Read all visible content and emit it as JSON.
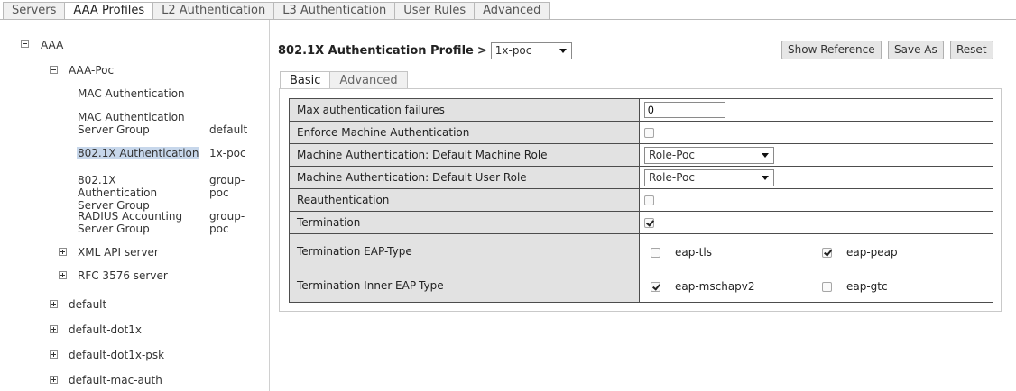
{
  "top_tabs": [
    {
      "label": "Servers"
    },
    {
      "label": "AAA Profiles",
      "active": true
    },
    {
      "label": "L2 Authentication"
    },
    {
      "label": "L3 Authentication"
    },
    {
      "label": "User Rules"
    },
    {
      "label": "Advanced"
    }
  ],
  "tree": {
    "root": "AAA",
    "aaa_poc": "AAA-Poc",
    "mac_auth": "MAC Authentication",
    "mac_auth_server_group": "MAC Authentication Server Group",
    "mac_auth_server_group_value": "default",
    "dot1x_auth": "802.1X Authentication",
    "dot1x_auth_value": "1x-poc",
    "dot1x_server_group": "802.1X Authentication Server Group",
    "dot1x_server_group_value": "group-poc",
    "radius_accounting": "RADIUS Accounting Server Group",
    "radius_accounting_value": "group-poc",
    "xml_api": "XML API server",
    "rfc3576": "RFC 3576 server",
    "default": "default",
    "default_dot1x": "default-dot1x",
    "default_dot1x_psk": "default-dot1x-psk",
    "default_mac_auth": "default-mac-auth"
  },
  "profile": {
    "title": "802.1X Authentication Profile",
    "gt": ">",
    "selected": "1x-poc"
  },
  "buttons": {
    "show_reference": "Show Reference",
    "save_as": "Save As",
    "reset": "Reset"
  },
  "sub_tabs": [
    {
      "label": "Basic",
      "active": true
    },
    {
      "label": "Advanced"
    }
  ],
  "rows": {
    "max_auth_failures": {
      "label": "Max authentication failures",
      "value": "0"
    },
    "enforce_machine_auth": {
      "label": "Enforce Machine Authentication",
      "checked": false
    },
    "default_machine_role": {
      "label": "Machine Authentication: Default Machine Role",
      "value": "Role-Poc"
    },
    "default_user_role": {
      "label": "Machine Authentication: Default User Role",
      "value": "Role-Poc"
    },
    "reauthentication": {
      "label": "Reauthentication",
      "checked": false
    },
    "termination": {
      "label": "Termination",
      "checked": true
    },
    "termination_eap_type": {
      "label": "Termination EAP-Type",
      "options": [
        {
          "label": "eap-tls",
          "checked": false
        },
        {
          "label": "eap-peap",
          "checked": true
        }
      ]
    },
    "termination_inner_eap_type": {
      "label": "Termination Inner EAP-Type",
      "options": [
        {
          "label": "eap-mschapv2",
          "checked": true
        },
        {
          "label": "eap-gtc",
          "checked": false
        }
      ]
    }
  }
}
